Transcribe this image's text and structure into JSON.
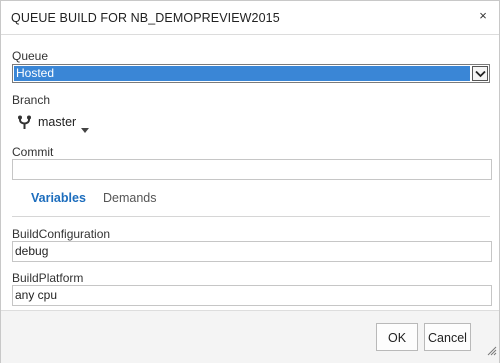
{
  "dialog": {
    "title": "QUEUE BUILD FOR NB_DEMOPREVIEW2015",
    "close_glyph": "×"
  },
  "queue": {
    "label": "Queue",
    "value": "Hosted"
  },
  "branch": {
    "label": "Branch",
    "value": "master"
  },
  "commit": {
    "label": "Commit",
    "value": ""
  },
  "tabs": [
    {
      "label": "Variables",
      "active": true
    },
    {
      "label": "Demands",
      "active": false
    }
  ],
  "variables": [
    {
      "name": "BuildConfiguration",
      "value": "debug"
    },
    {
      "name": "BuildPlatform",
      "value": "any cpu"
    }
  ],
  "footer": {
    "ok_label": "OK",
    "cancel_label": "Cancel"
  },
  "colors": {
    "accent": "#1c6dbd",
    "selection": "#3a86d6"
  }
}
